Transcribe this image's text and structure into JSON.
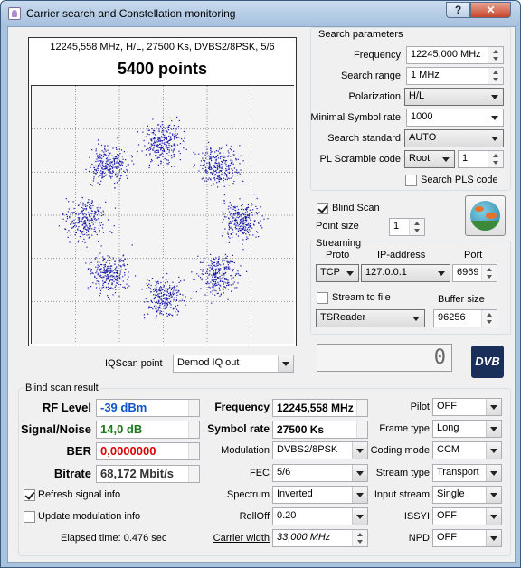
{
  "window": {
    "title": "Carrier search and Constellation monitoring",
    "buttons": {
      "help": "?",
      "close": "✕"
    }
  },
  "constellation": {
    "header": "12245,558 MHz, H/L, 27500 Ks, DVBS2/8PSK, 5/6",
    "points_label": "5400 points",
    "point_color": "#1a1aaa",
    "clusters": [
      {
        "i": 0.0,
        "q": 0.8
      },
      {
        "i": 0.56,
        "q": 0.56
      },
      {
        "i": 0.8,
        "q": 0.0
      },
      {
        "i": 0.56,
        "q": -0.56
      },
      {
        "i": 0.0,
        "q": -0.8
      },
      {
        "i": -0.56,
        "q": -0.56
      },
      {
        "i": -0.8,
        "q": 0.0
      },
      {
        "i": -0.56,
        "q": 0.56
      }
    ],
    "iqscan_label": "IQScan point",
    "iqscan_value": "Demod IQ out"
  },
  "search": {
    "group_title": "Search parameters",
    "frequency_label": "Frequency",
    "frequency_value": "12245,000 MHz",
    "range_label": "Search range",
    "range_value": "1 MHz",
    "polarization_label": "Polarization",
    "polarization_value": "H/L",
    "min_sr_label": "Minimal Symbol rate",
    "min_sr_value": "1000",
    "standard_label": "Search standard",
    "standard_value": "AUTO",
    "pl_label": "PL Scramble code",
    "pl_mode": "Root",
    "pl_value": "1",
    "search_pls_label": "Search PLS code",
    "blind_scan_label": "Blind Scan",
    "point_size_label": "Point size",
    "point_size_value": "1"
  },
  "streaming": {
    "title": "Streaming",
    "proto_label": "Proto",
    "proto_value": "TCP",
    "ip_label": "IP-address",
    "ip_value": "127.0.0.1",
    "port_label": "Port",
    "port_value": "6969",
    "stream_to_file_label": "Stream to file",
    "buffer_label": "Buffer size",
    "buffer_value": "96256",
    "reader_value": "TSReader",
    "lcd_value": "0",
    "logo_text": "DVB"
  },
  "result": {
    "title": "Blind scan result",
    "rf_label": "RF Level",
    "rf_value": "-39 dBm",
    "rf_color": "#1155cc",
    "sn_label": "Signal/Noise",
    "sn_value": "14,0 dB",
    "sn_color": "#1a7a1a",
    "ber_label": "BER",
    "ber_value": "0,0000000",
    "ber_color": "#dd0000",
    "bitrate_label": "Bitrate",
    "bitrate_value": "68,172 Mbit/s",
    "refresh_label": "Refresh signal info",
    "update_label": "Update modulation info",
    "elapsed_label": "Elapsed time: 0.476 sec",
    "freq_label": "Frequency",
    "freq_value": "12245,558 MHz",
    "sr_label": "Symbol rate",
    "sr_value": "27500 Ks",
    "mod_label": "Modulation",
    "mod_value": "DVBS2/8PSK",
    "fec_label": "FEC",
    "fec_value": "5/6",
    "spectrum_label": "Spectrum",
    "spectrum_value": "Inverted",
    "rolloff_label": "RollOff",
    "rolloff_value": "0.20",
    "cw_label": "Carrier width",
    "cw_value": "33,000 MHz",
    "pilot_label": "Pilot",
    "pilot_value": "OFF",
    "frame_label": "Frame type",
    "frame_value": "Long",
    "coding_label": "Coding mode",
    "coding_value": "CCM",
    "stream_label": "Stream type",
    "stream_value": "Transport",
    "input_label": "Input stream",
    "input_value": "Single",
    "issyi_label": "ISSYI",
    "issyi_value": "OFF",
    "npd_label": "NPD",
    "npd_value": "OFF"
  }
}
